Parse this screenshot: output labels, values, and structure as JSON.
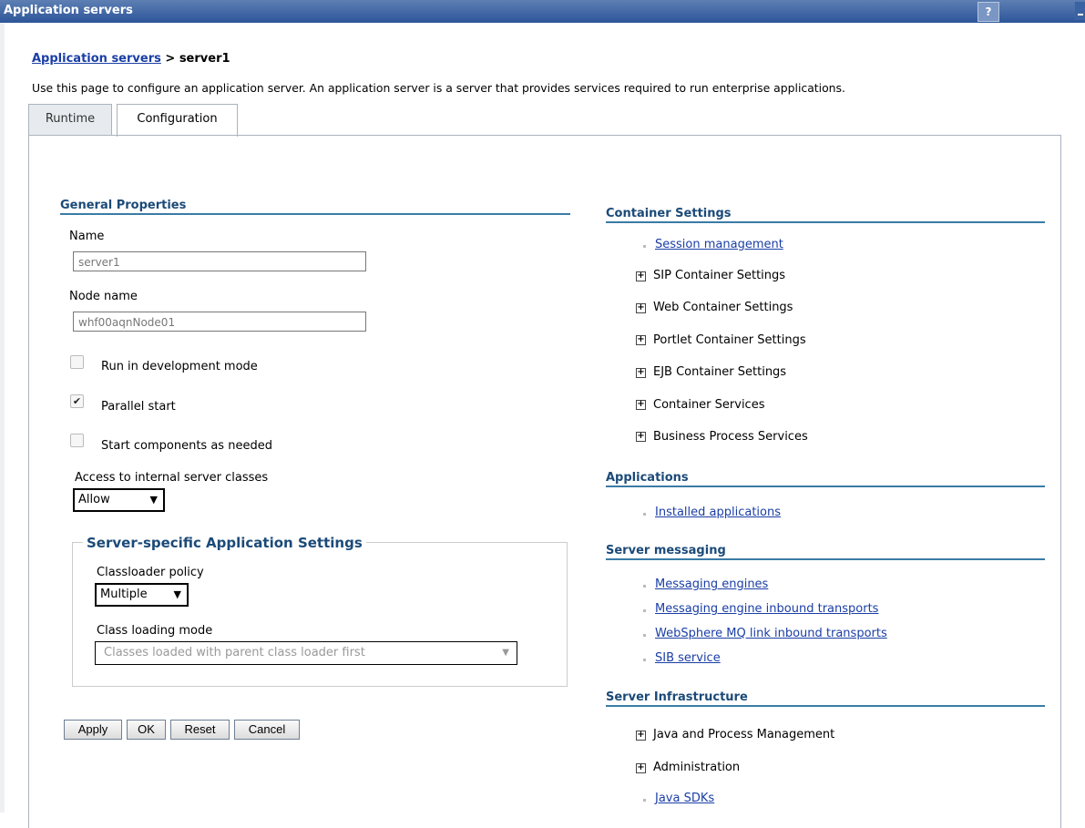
{
  "window": {
    "title": "Application servers",
    "help_label": "?"
  },
  "breadcrumb": {
    "link": "Application servers",
    "separator": " > ",
    "current": "server1"
  },
  "description": "Use this page to configure an application server. An application server is a server that provides services required to run enterprise applications.",
  "tabs": [
    {
      "label": "Runtime"
    },
    {
      "label": "Configuration"
    }
  ],
  "general": {
    "heading": "General Properties",
    "name_label": "Name",
    "name_value": "server1",
    "node_label": "Node name",
    "node_value": "whf00aqnNode01",
    "checkboxes": [
      {
        "label": "Run in development mode",
        "checked": false
      },
      {
        "label": "Parallel start",
        "checked": true
      },
      {
        "label": "Start components as needed",
        "checked": false
      }
    ],
    "access_label": "Access to internal server classes",
    "access_value": "Allow",
    "arrow": "▼",
    "check_mark": "✔"
  },
  "server_specific": {
    "legend": "Server-specific Application Settings",
    "classloader_label": "Classloader policy",
    "classloader_value": "Multiple",
    "mode_label": "Class loading mode",
    "mode_value": "Classes loaded with parent class loader first"
  },
  "buttons": [
    {
      "label": "Apply"
    },
    {
      "label": "OK"
    },
    {
      "label": "Reset"
    },
    {
      "label": "Cancel"
    }
  ],
  "right": {
    "plus_glyph": "+",
    "container": {
      "heading": "Container Settings",
      "link": "Session management",
      "items": [
        "SIP Container Settings",
        "Web Container Settings",
        "Portlet Container Settings",
        "EJB Container Settings",
        "Container Services",
        "Business Process Services"
      ]
    },
    "applications": {
      "heading": "Applications",
      "link": "Installed applications"
    },
    "messaging": {
      "heading": "Server messaging",
      "links": [
        "Messaging engines",
        "Messaging engine inbound transports",
        "WebSphere MQ link inbound transports",
        "SIB service"
      ]
    },
    "infrastructure": {
      "heading": "Server Infrastructure",
      "items": [
        "Java and Process Management",
        "Administration"
      ],
      "link": "Java SDKs"
    }
  }
}
